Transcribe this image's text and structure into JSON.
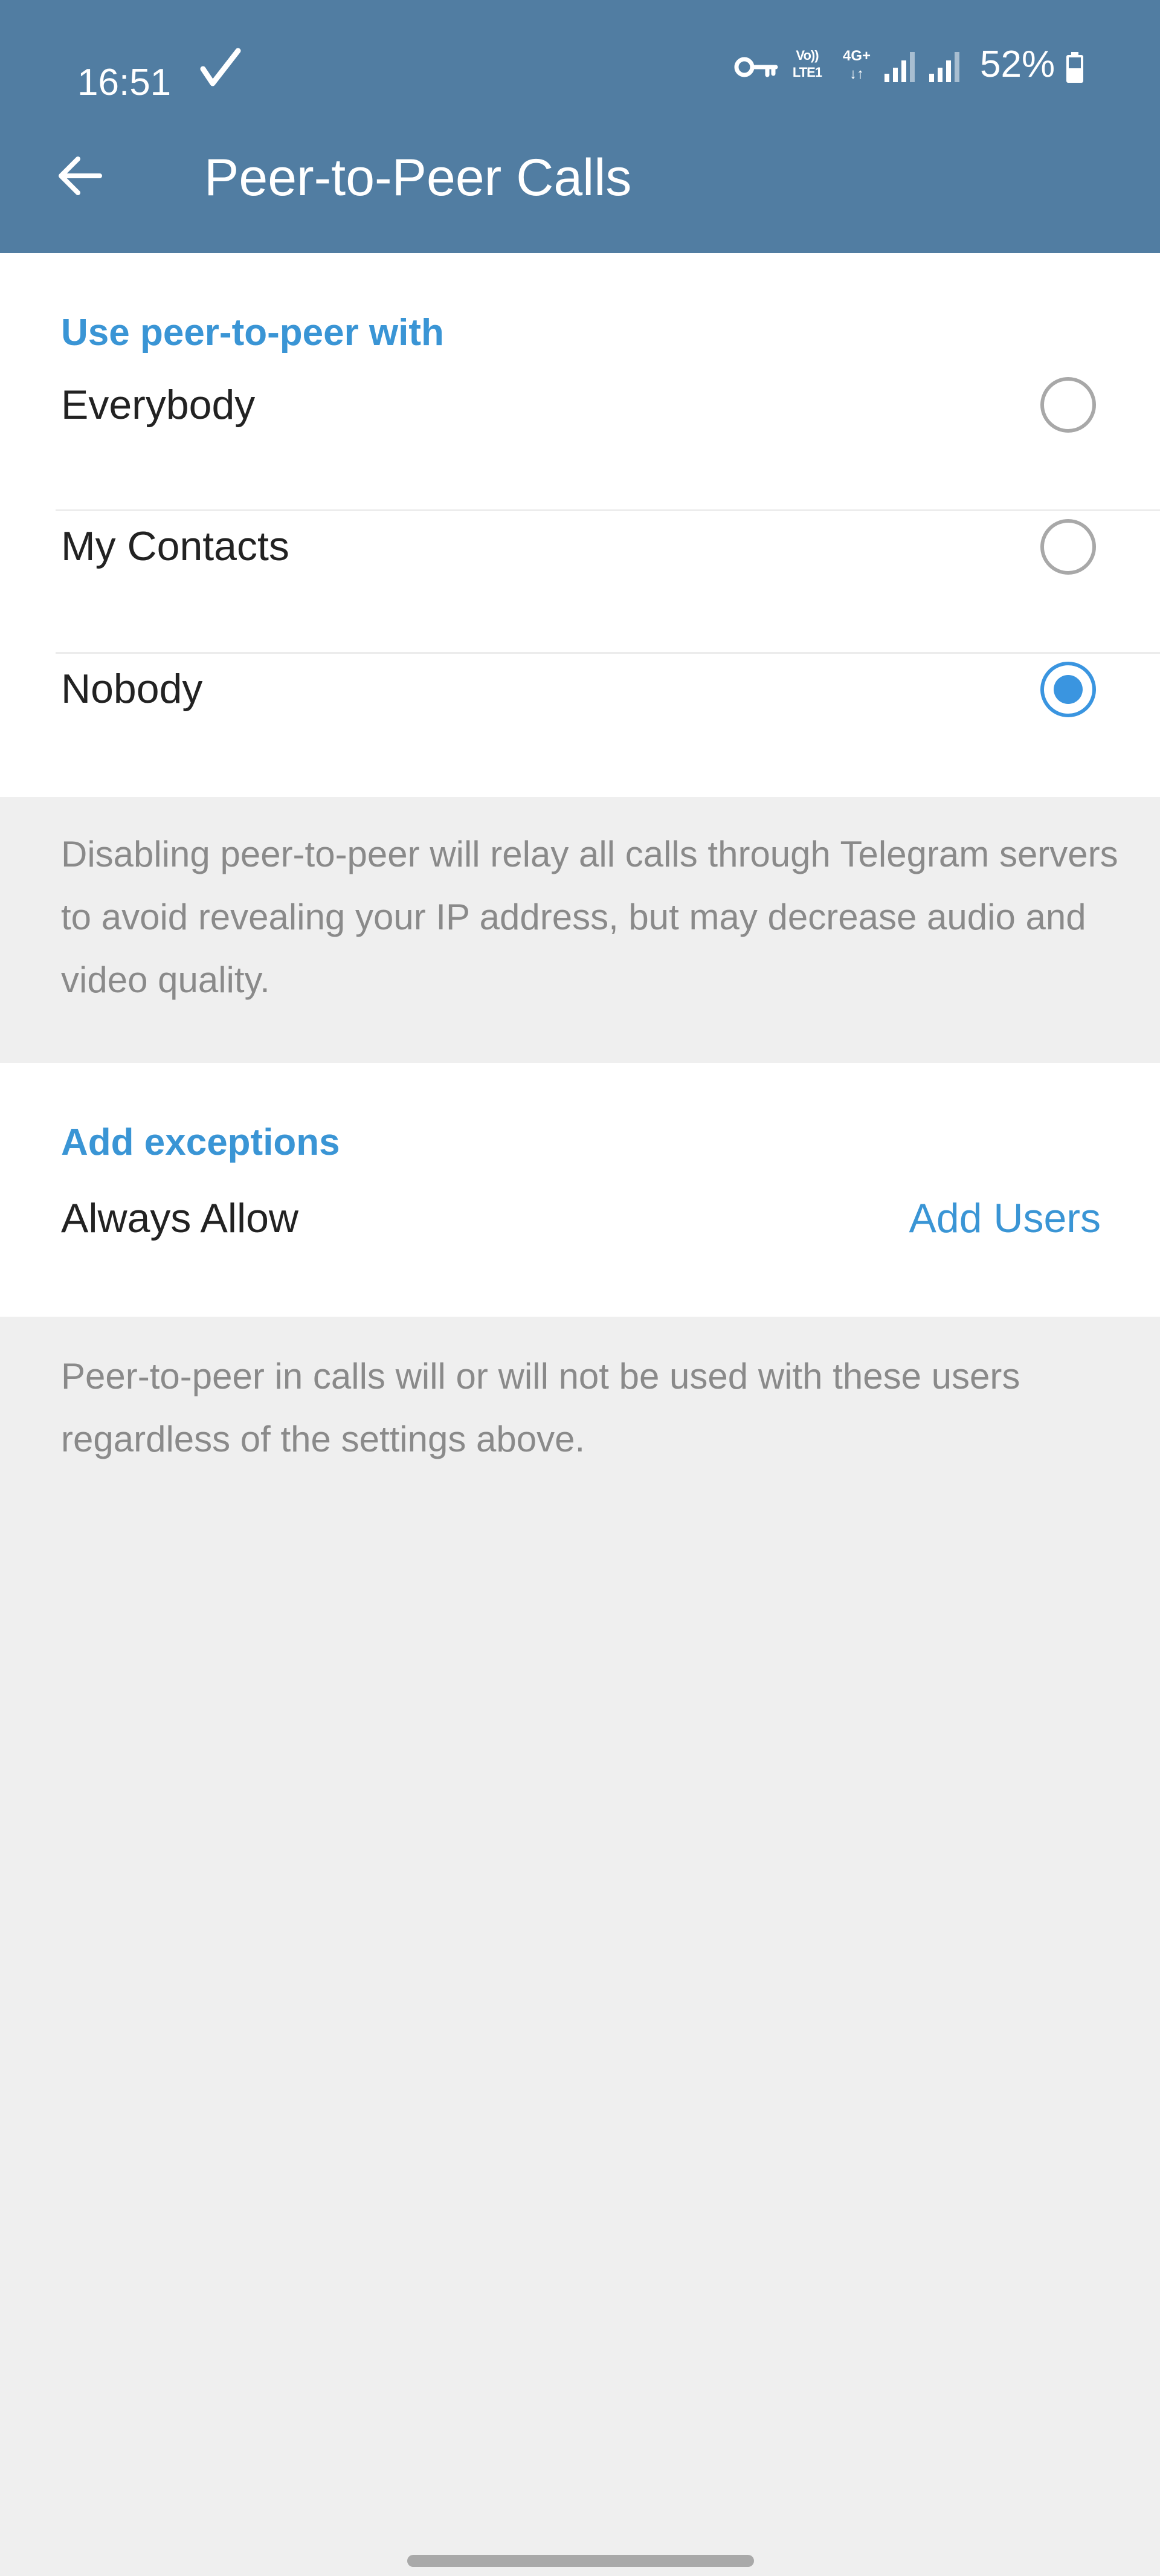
{
  "status_bar": {
    "time": "16:51",
    "volte_top": "Vo))",
    "volte_bottom": "LTE1",
    "network_top": "4G+",
    "network_bottom": "↓↑",
    "battery": "52%"
  },
  "header": {
    "title": "Peer-to-Peer Calls",
    "back_icon": "arrow-left-icon"
  },
  "peer_section": {
    "header": "Use peer-to-peer with",
    "options": [
      {
        "label": "Everybody",
        "selected": false
      },
      {
        "label": "My Contacts",
        "selected": false
      },
      {
        "label": "Nobody",
        "selected": true
      }
    ],
    "info": "Disabling peer-to-peer will relay all calls through Telegram servers to avoid revealing your IP address, but may decrease audio and video quality."
  },
  "exceptions_section": {
    "header": "Add exceptions",
    "always_allow_label": "Always Allow",
    "add_users_label": "Add Users",
    "info": "Peer-to-peer in calls will or will not be used with these users regardless of the settings above."
  },
  "colors": {
    "header_bg": "#517da2",
    "accent": "#3a95d5",
    "background": "#efefef"
  }
}
